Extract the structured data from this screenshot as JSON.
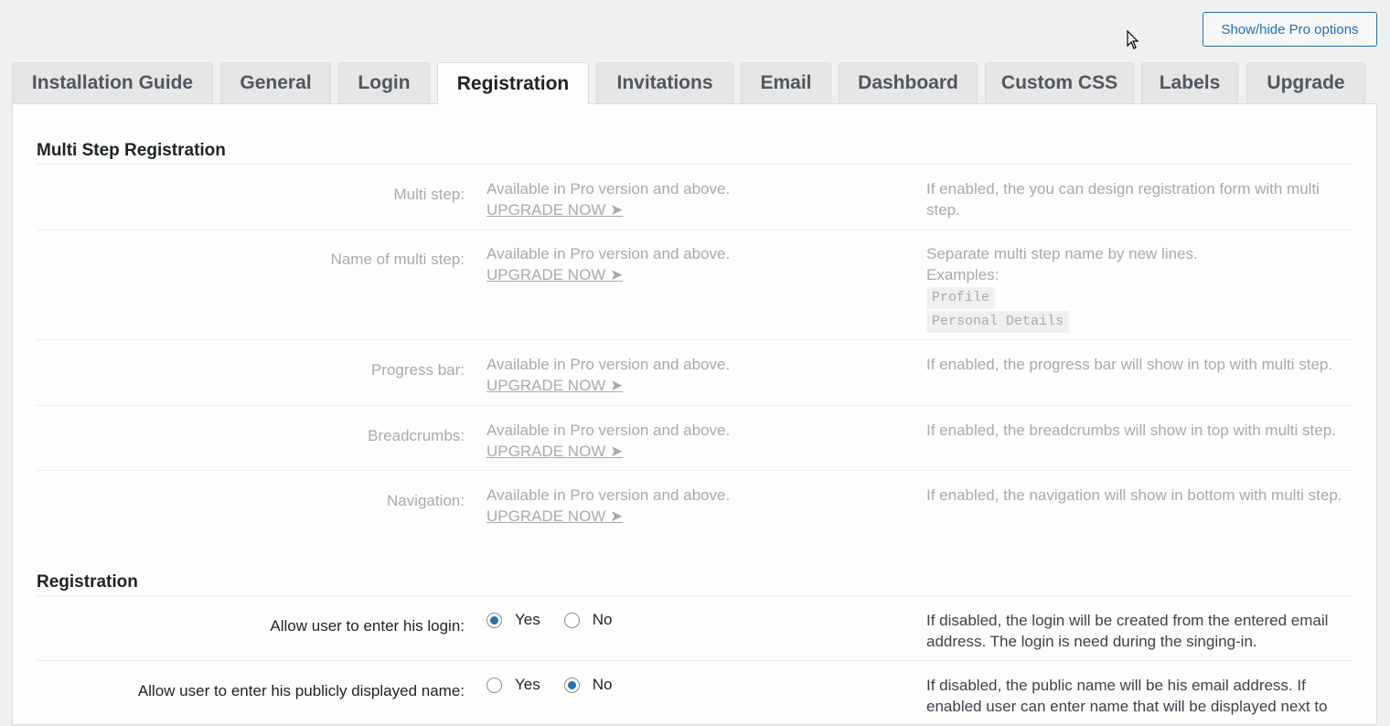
{
  "toolbar": {
    "toggle_pro_label": "Show/hide Pro options"
  },
  "tabs": [
    {
      "label": "Installation Guide",
      "active": false
    },
    {
      "label": "General",
      "active": false
    },
    {
      "label": "Login",
      "active": false
    },
    {
      "label": "Registration",
      "active": true
    },
    {
      "label": "Invitations",
      "active": false
    },
    {
      "label": "Email",
      "active": false
    },
    {
      "label": "Dashboard",
      "active": false
    },
    {
      "label": "Custom CSS",
      "active": false
    },
    {
      "label": "Labels",
      "active": false
    },
    {
      "label": "Upgrade",
      "active": false
    }
  ],
  "multi_step": {
    "title": "Multi Step Registration",
    "pro_text": "Available in Pro version and above.",
    "upgrade_text": "UPGRADE NOW ➤",
    "rows": [
      {
        "label": "Multi step:",
        "help": "If enabled, the you can design registration form with multi step."
      },
      {
        "label": "Name of multi step:",
        "help": "Separate multi step name by new lines.",
        "examples_label": "Examples:",
        "examples": [
          "Profile",
          "Personal Details"
        ]
      },
      {
        "label": "Progress bar:",
        "help": "If enabled, the progress bar will show in top with multi step."
      },
      {
        "label": "Breadcrumbs:",
        "help": "If enabled, the breadcrumbs will show in top with multi step."
      },
      {
        "label": "Navigation:",
        "help": "If enabled, the navigation will show in bottom with multi step."
      }
    ]
  },
  "registration": {
    "title": "Registration",
    "yes_label": "Yes",
    "no_label": "No",
    "rows": [
      {
        "label": "Allow user to enter his login:",
        "selected": "yes",
        "help": "If disabled, the login will be created from the entered email address. The login is need during the singing-in."
      },
      {
        "label": "Allow user to enter his publicly displayed name:",
        "selected": "no",
        "help": "If disabled, the public name will be his email address. If enabled user can enter name that will be displayed next to"
      }
    ]
  },
  "colors": {
    "accent": "#2271b1",
    "muted_text": "#a7aaad"
  }
}
